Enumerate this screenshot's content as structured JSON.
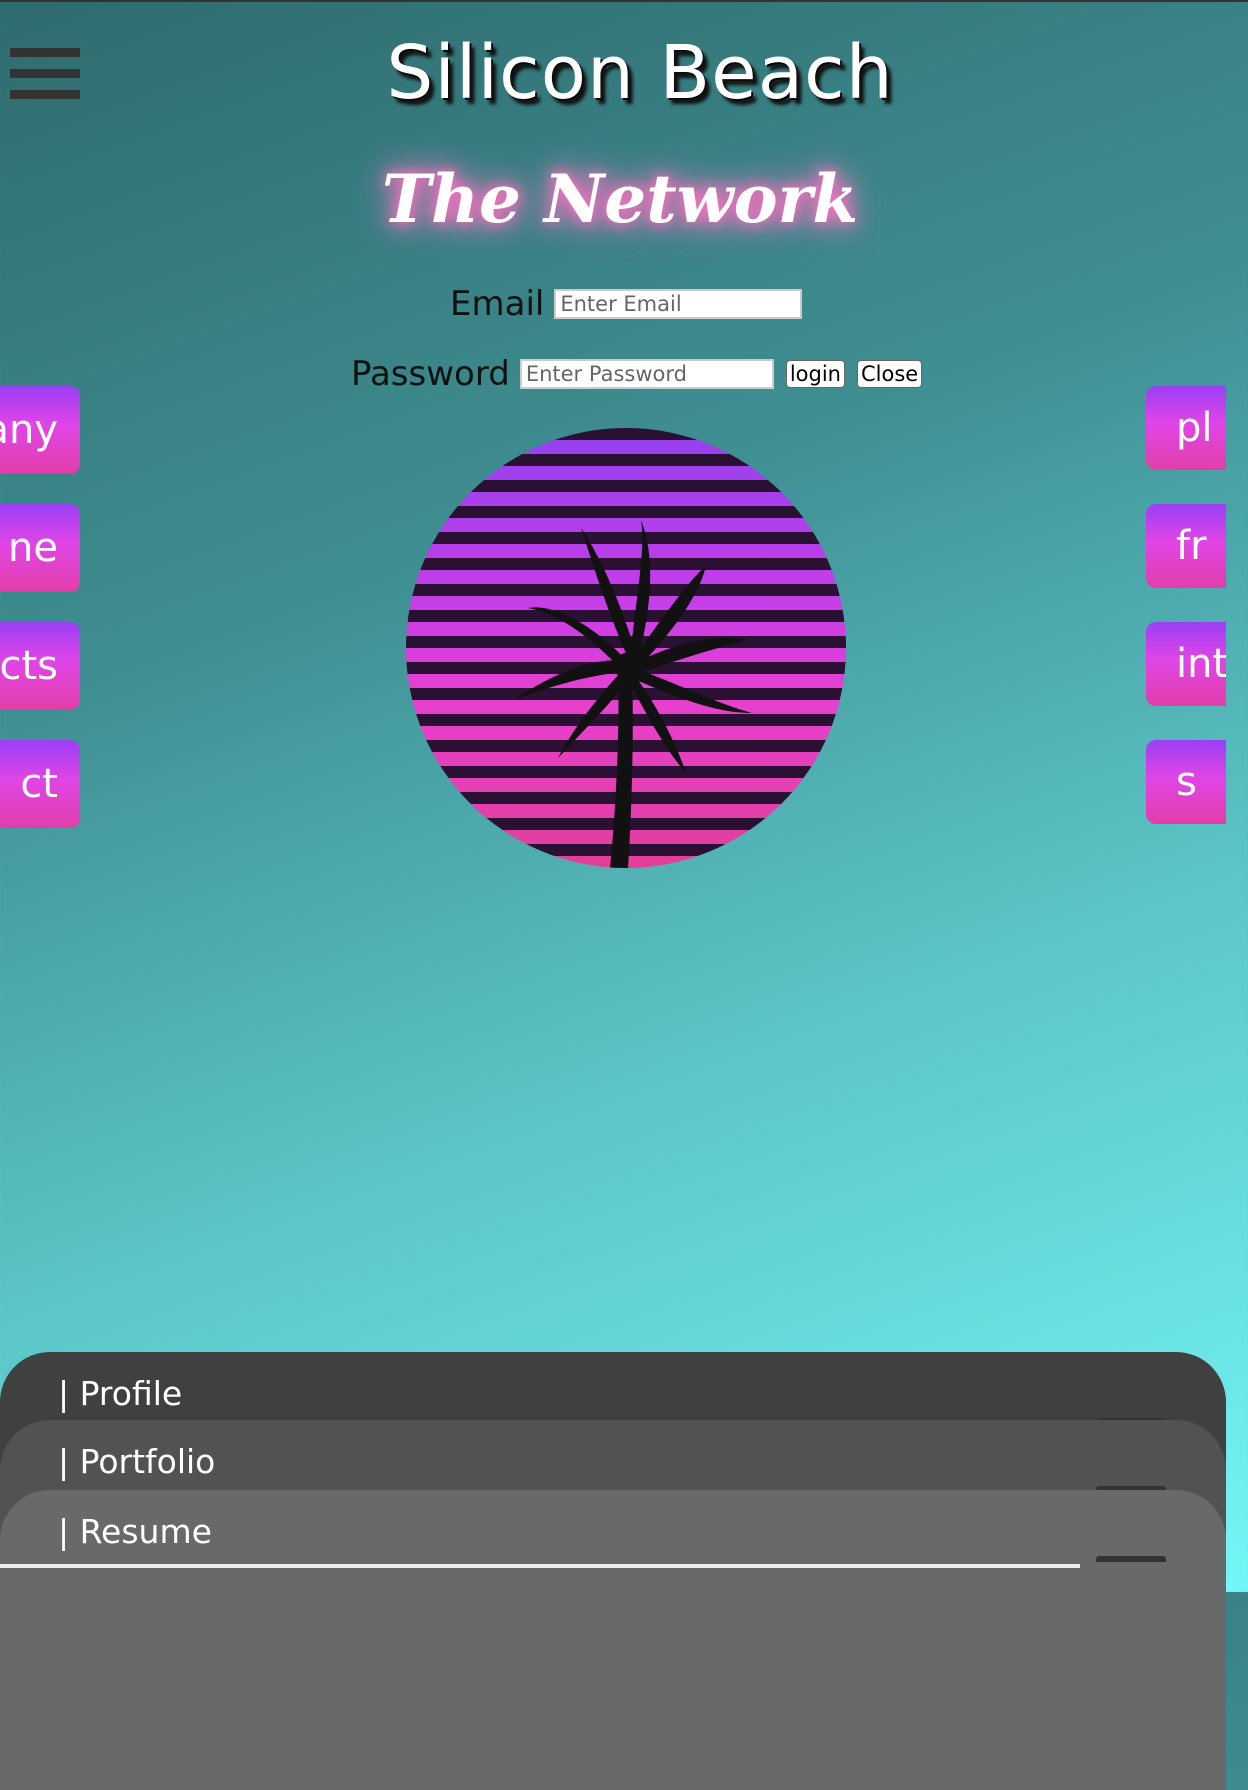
{
  "header": {
    "title": "Silicon Beach",
    "subtitle": "The Network",
    "menu_icon": "hamburger-menu-icon"
  },
  "login": {
    "email_label": "Email",
    "email_placeholder": "Enter Email",
    "password_label": "Password",
    "password_placeholder": "Enter Password",
    "login_button": "login",
    "close_button": "Close"
  },
  "left_nav": [
    "any",
    "ne",
    "cts",
    "ct"
  ],
  "right_nav": [
    "pl",
    "fr",
    "int",
    "s"
  ],
  "logo": {
    "icon": "palm-tree-sunset-icon"
  },
  "bottom_panels": [
    "| Profile",
    "| Portfolio",
    "| Resume"
  ],
  "colors": {
    "background_dark": "#2f6b6e",
    "background_light": "#74f6f7",
    "button_purple": "#9b3ff5",
    "button_pink": "#e23ea9",
    "subtitle_glow": "#ff6fc0"
  }
}
